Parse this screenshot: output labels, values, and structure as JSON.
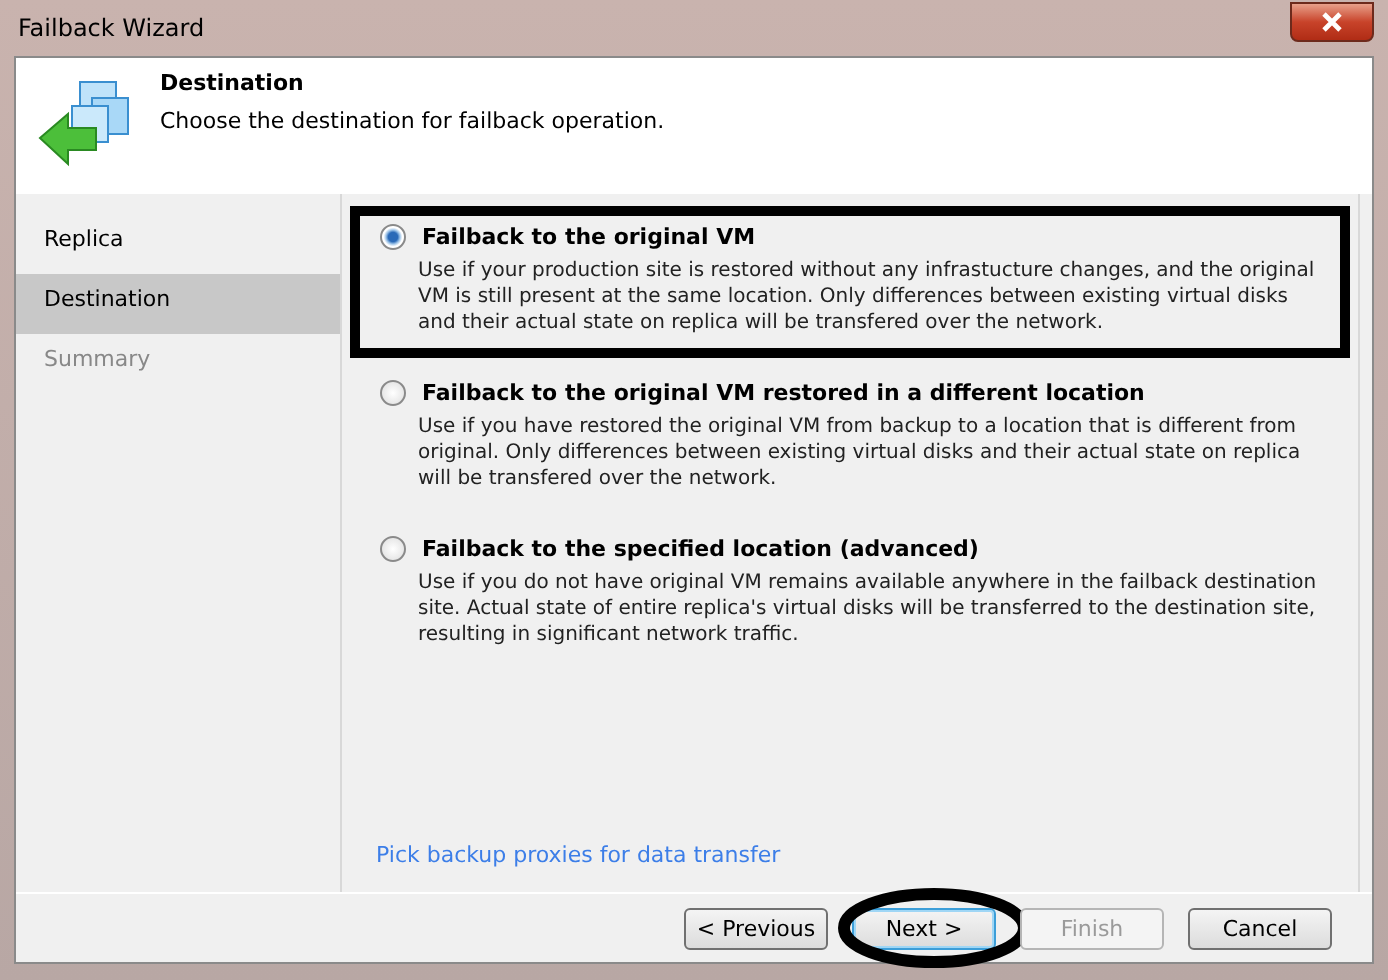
{
  "window": {
    "title": "Failback Wizard"
  },
  "header": {
    "title": "Destination",
    "subtitle": "Choose the destination for failback operation."
  },
  "steps": [
    {
      "label": "Replica",
      "selected": false,
      "disabled": false
    },
    {
      "label": "Destination",
      "selected": true,
      "disabled": false
    },
    {
      "label": "Summary",
      "selected": false,
      "disabled": true
    }
  ],
  "options": [
    {
      "label": "Failback to the original VM",
      "description": "Use if your production site is restored without any infrastucture changes, and the original VM is still present at the same location.  Only differences between existing virtual disks and their actual state on replica will be transfered over the network.",
      "selected": true,
      "highlighted": true
    },
    {
      "label": "Failback to the original VM restored in a different location",
      "description": "Use if you have restored the original VM from backup to a location that is different from original. Only differences between existing virtual disks and their actual state on replica will be transfered over the network.",
      "selected": false,
      "highlighted": false
    },
    {
      "label": "Failback to the specified location (advanced)",
      "description": "Use if you do not have original VM remains available anywhere in the failback destination site. Actual state of entire replica's virtual disks will be transferred to the destination site, resulting in significant network traffic.",
      "selected": false,
      "highlighted": false
    }
  ],
  "link": "Pick backup proxies for data transfer",
  "buttons": [
    {
      "label": "< Previous",
      "disabled": false,
      "focused": false,
      "highlighted": false
    },
    {
      "label": "Next >",
      "disabled": false,
      "focused": true,
      "highlighted": true
    },
    {
      "label": "Finish",
      "disabled": true,
      "focused": false,
      "highlighted": false
    },
    {
      "label": "Cancel",
      "disabled": false,
      "focused": false,
      "highlighted": false
    }
  ]
}
